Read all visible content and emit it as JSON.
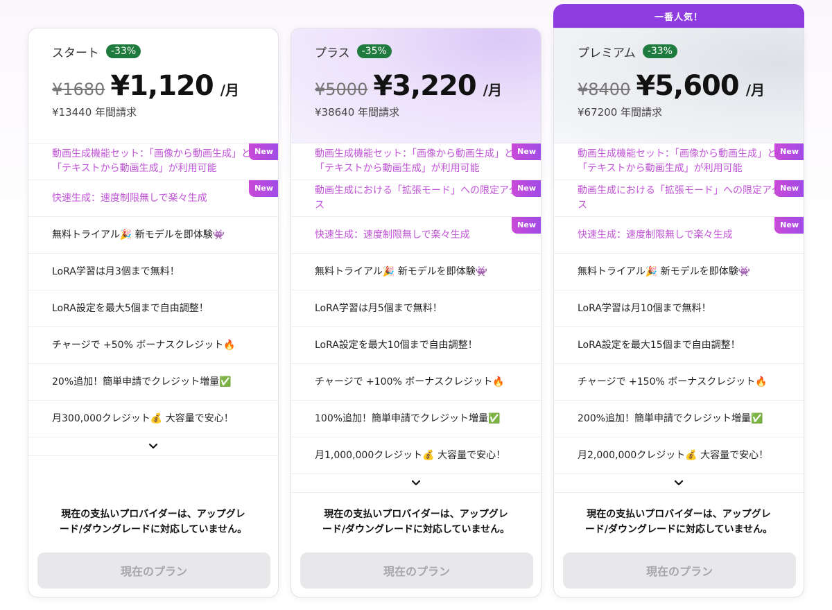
{
  "popular_label": "一番人気！",
  "current_plan_label": "現在のプラン",
  "notice_lines": [
    "現在の支払いプロバイダーは、アップグレ",
    "ード/ダウングレードに対応していません。"
  ],
  "new_label": "New",
  "plans": [
    {
      "name": "スタート",
      "discount": "-33%",
      "old_price": "¥1680",
      "price": "¥1,120",
      "per": "/月",
      "annual": "¥13440 年間請求",
      "features": [
        {
          "lines": [
            "動画生成機能セット：「画像から動画生成」と",
            "「テキストから動画生成」が利用可能"
          ],
          "new": true,
          "highlight": true
        },
        {
          "lines": [
            "快速生成：速度制限無しで楽々生成"
          ],
          "new": true,
          "highlight": true
        },
        {
          "lines": [
            "無料トライアル🎉 新モデルを即体験👾"
          ],
          "new": false,
          "highlight": false
        },
        {
          "lines": [
            "LoRA学習は月3個まで無料！"
          ],
          "new": false,
          "highlight": false
        },
        {
          "lines": [
            "LoRA設定を最大5個まで自由調整！"
          ],
          "new": false,
          "highlight": false
        },
        {
          "lines": [
            "チャージで +50% ボーナスクレジット🔥"
          ],
          "new": false,
          "highlight": false
        },
        {
          "lines": [
            "20%追加！簡単申請でクレジット増量✅"
          ],
          "new": false,
          "highlight": false
        },
        {
          "lines": [
            "月300,000クレジット💰 大容量で安心！"
          ],
          "new": false,
          "highlight": false
        }
      ]
    },
    {
      "name": "プラス",
      "discount": "-35%",
      "old_price": "¥5000",
      "price": "¥3,220",
      "per": "/月",
      "annual": "¥38640 年間請求",
      "features": [
        {
          "lines": [
            "動画生成機能セット：「画像から動画生成」と",
            "「テキストから動画生成」が利用可能"
          ],
          "new": true,
          "highlight": true
        },
        {
          "lines": [
            "動画生成における「拡張モード」への限定アクセ",
            "ス"
          ],
          "new": true,
          "highlight": true
        },
        {
          "lines": [
            "快速生成：速度制限無しで楽々生成"
          ],
          "new": true,
          "highlight": true
        },
        {
          "lines": [
            "無料トライアル🎉 新モデルを即体験👾"
          ],
          "new": false,
          "highlight": false
        },
        {
          "lines": [
            "LoRA学習は月5個まで無料！"
          ],
          "new": false,
          "highlight": false
        },
        {
          "lines": [
            "LoRA設定を最大10個まで自由調整！"
          ],
          "new": false,
          "highlight": false
        },
        {
          "lines": [
            "チャージで +100% ボーナスクレジット🔥"
          ],
          "new": false,
          "highlight": false
        },
        {
          "lines": [
            "100%追加！簡単申請でクレジット増量✅"
          ],
          "new": false,
          "highlight": false
        },
        {
          "lines": [
            "月1,000,000クレジット💰 大容量で安心！"
          ],
          "new": false,
          "highlight": false
        }
      ]
    },
    {
      "name": "プレミアム",
      "discount": "-33%",
      "old_price": "¥8400",
      "price": "¥5,600",
      "per": "/月",
      "annual": "¥67200 年間請求",
      "features": [
        {
          "lines": [
            "動画生成機能セット：「画像から動画生成」と",
            "「テキストから動画生成」が利用可能"
          ],
          "new": true,
          "highlight": true
        },
        {
          "lines": [
            "動画生成における「拡張モード」への限定アクセ",
            "ス"
          ],
          "new": true,
          "highlight": true
        },
        {
          "lines": [
            "快速生成：速度制限無しで楽々生成"
          ],
          "new": true,
          "highlight": true
        },
        {
          "lines": [
            "無料トライアル🎉 新モデルを即体験👾"
          ],
          "new": false,
          "highlight": false
        },
        {
          "lines": [
            "LoRA学習は月10個まで無料！"
          ],
          "new": false,
          "highlight": false
        },
        {
          "lines": [
            "LoRA設定を最大15個まで自由調整！"
          ],
          "new": false,
          "highlight": false
        },
        {
          "lines": [
            "チャージで +150% ボーナスクレジット🔥"
          ],
          "new": false,
          "highlight": false
        },
        {
          "lines": [
            "200%追加！簡単申請でクレジット増量✅"
          ],
          "new": false,
          "highlight": false
        },
        {
          "lines": [
            "月2,000,000クレジット💰 大容量で安心！"
          ],
          "new": false,
          "highlight": false
        }
      ]
    }
  ]
}
